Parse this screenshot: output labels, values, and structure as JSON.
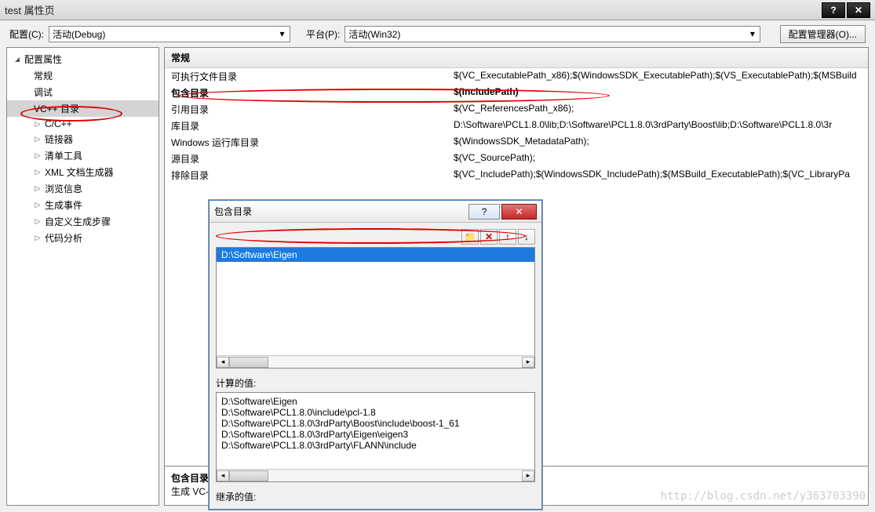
{
  "window": {
    "title": "test 属性页"
  },
  "toprow": {
    "config_label": "配置(C):",
    "config_value": "活动(Debug)",
    "platform_label": "平台(P):",
    "platform_value": "活动(Win32)",
    "manager_btn": "配置管理器(O)..."
  },
  "tree": {
    "root": "配置属性",
    "items": [
      "常规",
      "调试",
      "VC++ 目录",
      "C/C++",
      "链接器",
      "清单工具",
      "XML 文档生成器",
      "浏览信息",
      "生成事件",
      "自定义生成步骤",
      "代码分析"
    ]
  },
  "grid": {
    "section": "常规",
    "rows": [
      {
        "k": "可执行文件目录",
        "v": "$(VC_ExecutablePath_x86);$(WindowsSDK_ExecutablePath);$(VS_ExecutablePath);$(MSBuild"
      },
      {
        "k": "包含目录",
        "v": "$(IncludePath)"
      },
      {
        "k": "引用目录",
        "v": "$(VC_ReferencesPath_x86);"
      },
      {
        "k": "库目录",
        "v": "D:\\Software\\PCL1.8.0\\lib;D:\\Software\\PCL1.8.0\\3rdParty\\Boost\\lib;D:\\Software\\PCL1.8.0\\3r"
      },
      {
        "k": "Windows 运行库目录",
        "v": "$(WindowsSDK_MetadataPath);"
      },
      {
        "k": "源目录",
        "v": "$(VC_SourcePath);"
      },
      {
        "k": "排除目录",
        "v": "$(VC_IncludePath);$(WindowsSDK_IncludePath);$(MSBuild_ExecutablePath);$(VC_LibraryPa"
      }
    ]
  },
  "desc": {
    "title": "包含目录",
    "text": "生成 VC-"
  },
  "dialog": {
    "title": "包含目录",
    "entry": "D:\\Software\\Eigen",
    "calc_label": "计算的值:",
    "calc_lines": [
      "D:\\Software\\Eigen",
      "D:\\Software\\PCL1.8.0\\include\\pcl-1.8",
      "D:\\Software\\PCL1.8.0\\3rdParty\\Boost\\include\\boost-1_61",
      "D:\\Software\\PCL1.8.0\\3rdParty\\Eigen\\eigen3",
      "D:\\Software\\PCL1.8.0\\3rdParty\\FLANN\\include"
    ],
    "inherit_label": "继承的值:"
  },
  "watermark": "http://blog.csdn.net/y363703390"
}
